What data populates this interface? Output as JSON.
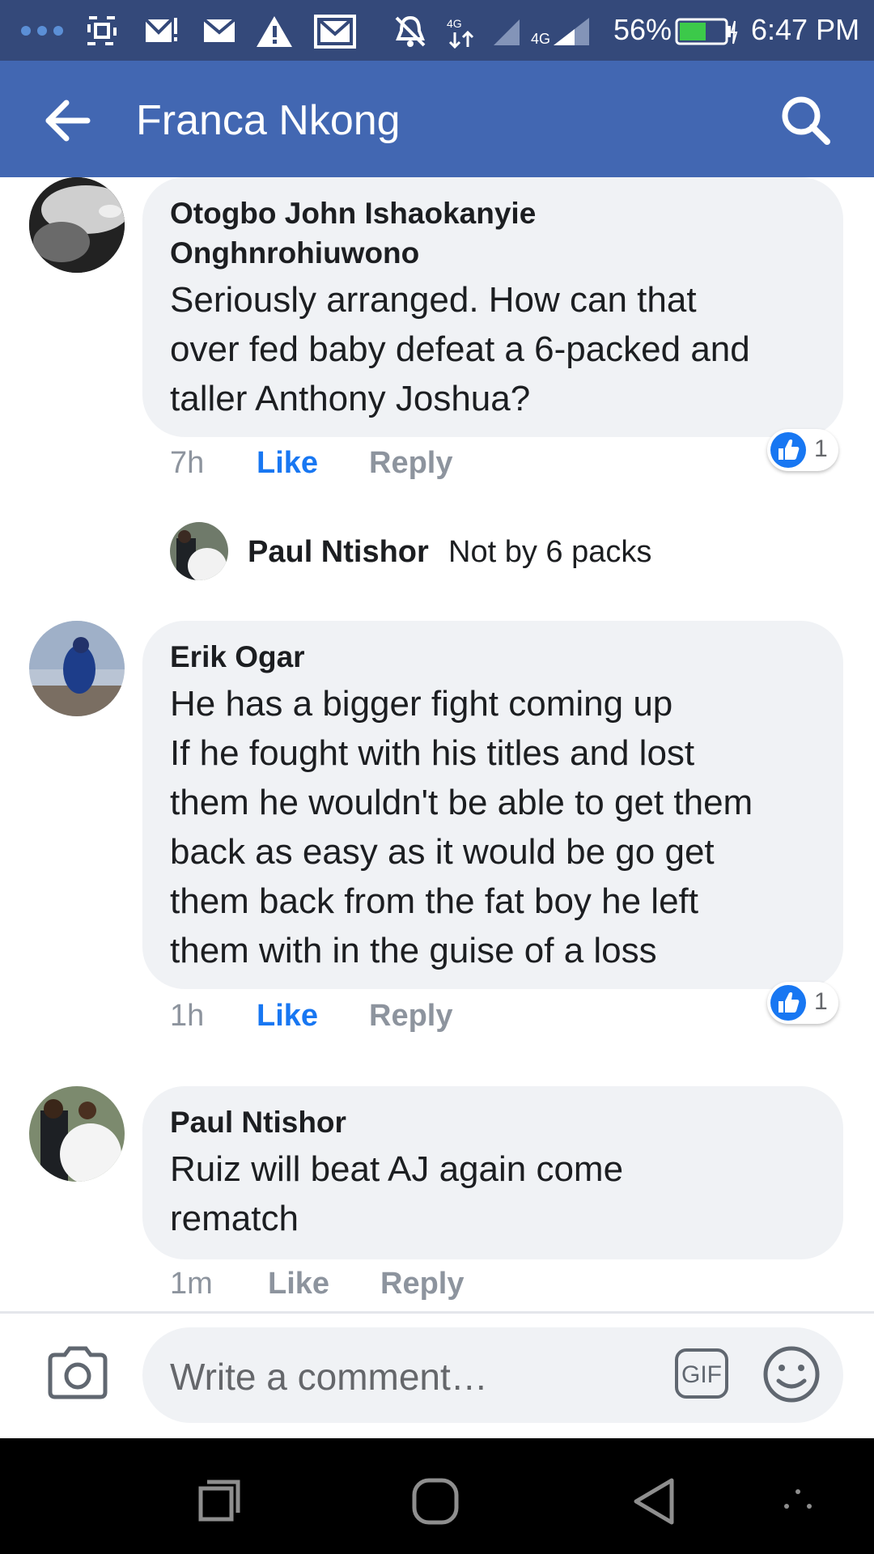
{
  "status_bar": {
    "battery": "56%",
    "time": "6:47 PM",
    "network_label": "4G"
  },
  "header": {
    "title": "Franca Nkong"
  },
  "comments": [
    {
      "author": "Otogbo John Ishaokanyie Onghnrohiuwono",
      "author_lines": [
        "Otogbo John Ishaokanyie",
        "Onghnrohiuwono"
      ],
      "text_lines": [
        "Seriously arranged. How can that",
        "over fed baby defeat a 6-packed and",
        "taller Anthony Joshua?"
      ],
      "time": "7h",
      "like": "Like",
      "reply": "Reply",
      "reaction_count": "1"
    },
    {
      "author": "Erik Ogar",
      "text_lines": [
        "He has a bigger fight coming up",
        "If he fought with his titles and lost",
        "them he wouldn't be able to get them",
        "back as easy as it would be go get",
        "them back from the fat boy he left",
        "them with in the guise of a loss"
      ],
      "time": "1h",
      "like": "Like",
      "reply": "Reply",
      "reaction_count": "1"
    },
    {
      "author": "Paul Ntishor",
      "text_lines": [
        "Ruiz will beat AJ again come",
        "rematch"
      ],
      "time": "1m",
      "like": "Like",
      "reply": "Reply"
    }
  ],
  "reply_preview": {
    "author": "Paul Ntishor",
    "text": "Not by 6 packs"
  },
  "composer": {
    "placeholder": "Write a comment…",
    "gif_label": "GIF"
  },
  "icons": {
    "back": "arrow-left-icon",
    "search": "search-icon",
    "camera": "camera-icon",
    "gif": "gif-icon",
    "emoji": "smiley-icon",
    "like_reaction": "thumbs-up-icon",
    "nav_recents": "recents-icon",
    "nav_home": "home-icon",
    "nav_back": "triangle-back-icon"
  },
  "colors": {
    "app_bar": "#4267b2",
    "status_bar": "#34497a",
    "like_active": "#1877f2",
    "bubble": "#f0f2f5"
  }
}
